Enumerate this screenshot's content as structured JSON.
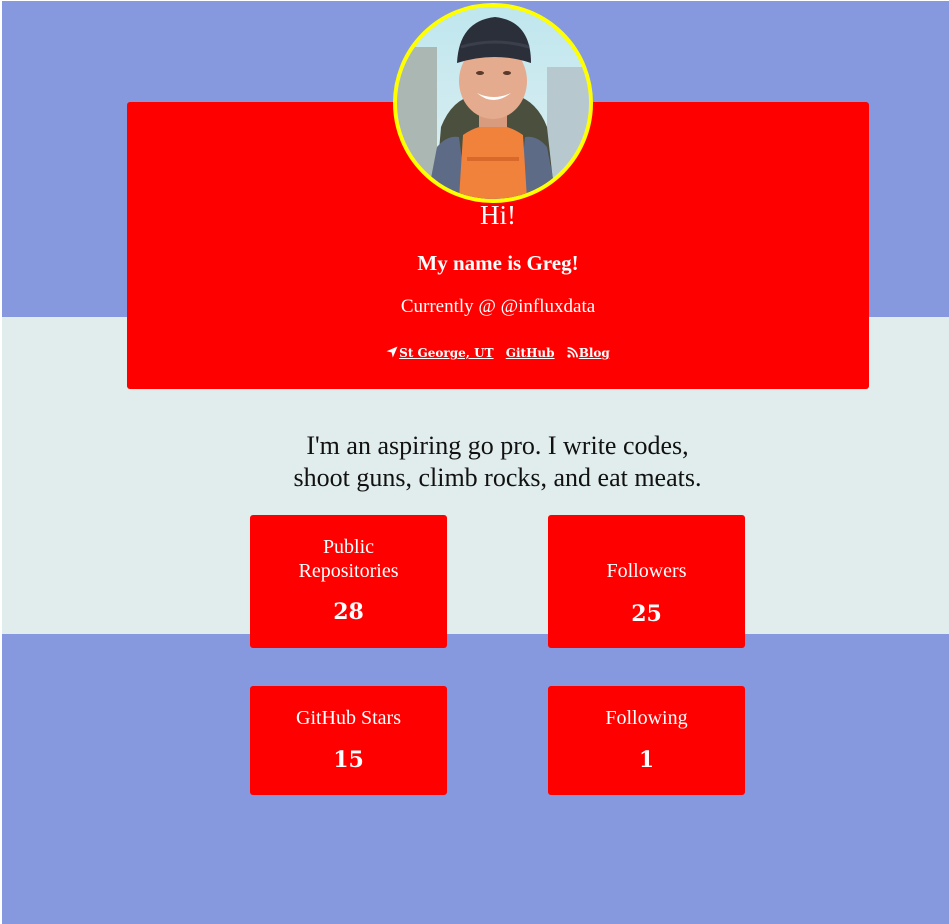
{
  "profile": {
    "greeting": "Hi!",
    "name": "My name is Greg!",
    "current": "Currently @ @influxdata",
    "links": {
      "location": "St George, UT",
      "github": "GitHub",
      "blog": "Blog"
    }
  },
  "bio": {
    "line1": "I'm an aspiring go pro. I write codes,",
    "line2": "shoot guns, climb rocks, and eat meats."
  },
  "stats": [
    {
      "label": "Public Repositories",
      "value": "28"
    },
    {
      "label": "Followers",
      "value": "25"
    },
    {
      "label": "GitHub Stars",
      "value": "15"
    },
    {
      "label": "Following",
      "value": "1"
    }
  ],
  "colors": {
    "page_background": "#8699de",
    "mid_band": "#e1ecec",
    "card": "#ff0000",
    "avatar_border": "#ffff00",
    "text_on_card": "#ffffff"
  },
  "icons": {
    "location": "location-arrow-icon",
    "blog": "rss-icon"
  }
}
